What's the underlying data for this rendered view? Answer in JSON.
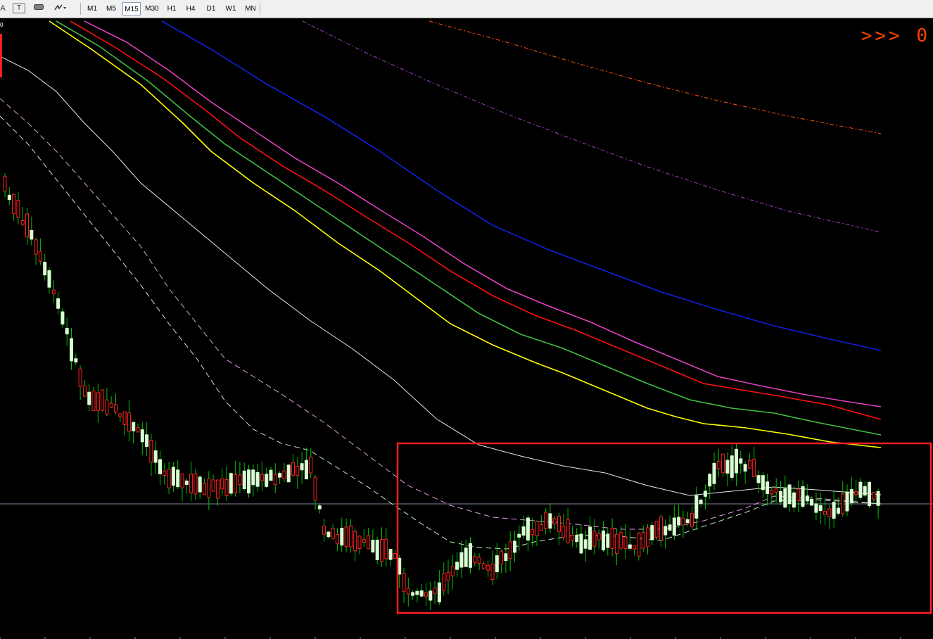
{
  "toolbar": {
    "left_icon_a": "A",
    "text_tool_label": "T",
    "timeframes": [
      {
        "label": "M1",
        "active": false
      },
      {
        "label": "M5",
        "active": false
      },
      {
        "label": "M15",
        "active": true
      },
      {
        "label": "M30",
        "active": false
      },
      {
        "label": "H1",
        "active": false
      },
      {
        "label": "H4",
        "active": false
      },
      {
        "label": "D1",
        "active": false
      },
      {
        "label": "W1",
        "active": false
      },
      {
        "label": "MN",
        "active": false
      }
    ]
  },
  "chart": {
    "corner_text": ">>> 0",
    "left_label": "0",
    "colors": {
      "background": "#000000",
      "bull_candle": "#d8ffd0",
      "bear_candle": "#ff2020",
      "wick": "#00c000",
      "ma_yellow": "#ffff00",
      "ma_green": "#40c040",
      "ma_red": "#ff1010",
      "ma_magenta": "#e040c0",
      "ma_blue": "#1020e0",
      "ma_white": "#e8e8e8",
      "dash_violet": "#a040c0",
      "dash_orange": "#ff5010",
      "highlight_box": "#ff2020",
      "price_line": "#8080a0"
    }
  }
}
